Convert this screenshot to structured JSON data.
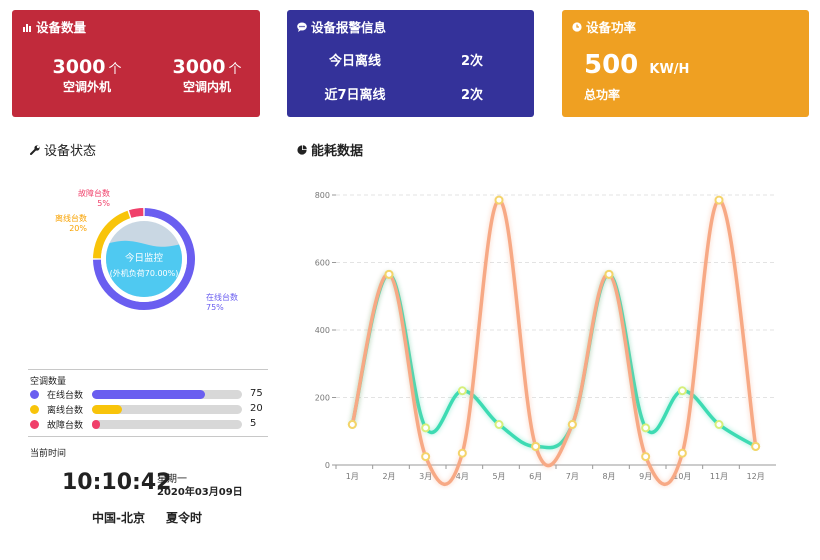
{
  "device_count": {
    "title": "设备数量",
    "icon": "bar-chart-icon",
    "outdoor": {
      "value": "3000",
      "unit": "个",
      "label": "空调外机"
    },
    "indoor": {
      "value": "3000",
      "unit": "个",
      "label": "空调内机"
    },
    "color": "#c12a3b"
  },
  "alarm_info": {
    "title": "设备报警信息",
    "icon": "chat-bubble-icon",
    "rows": [
      {
        "label": "今日离线",
        "value": "2次"
      },
      {
        "label": "近7日离线",
        "value": "2次"
      }
    ],
    "color": "#34329a"
  },
  "power": {
    "title": "设备功率",
    "icon": "clock-icon",
    "value": "500",
    "unit": "KW/H",
    "label": "总功率",
    "color": "#efa022"
  },
  "device_status": {
    "title": "设备状态",
    "icon": "wrench-icon",
    "center_label": "今日监控",
    "center_sub": "(外机负荷70.00%)",
    "load_fraction": 0.7,
    "segments": [
      {
        "name": "在线台数",
        "pct": "75%",
        "value": 75,
        "color": "#6a5ef0"
      },
      {
        "name": "离线台数",
        "pct": "20%",
        "value": 20,
        "color": "#f8c40a"
      },
      {
        "name": "故障台数",
        "pct": "5%",
        "value": 5,
        "color": "#f0406a"
      }
    ]
  },
  "ac_count": {
    "title": "空调数量",
    "rows": [
      {
        "label": "在线台数",
        "value": "75",
        "fraction": 0.75,
        "color": "#6a5ef0"
      },
      {
        "label": "离线台数",
        "value": "20",
        "fraction": 0.2,
        "color": "#f8c40a"
      },
      {
        "label": "故障台数",
        "value": "5",
        "fraction": 0.05,
        "color": "#f0406a"
      }
    ]
  },
  "clock": {
    "title": "当前时间",
    "time": "10:10:42",
    "weekday": "星期一",
    "date": "2020年03月09日",
    "location": "中国-北京",
    "dst": "夏令时"
  },
  "energy": {
    "title": "能耗数据",
    "icon": "pie-chart-icon"
  },
  "chart_data": {
    "type": "line",
    "title": "",
    "xlabel": "",
    "ylabel": "",
    "categories": [
      "1月",
      "2月",
      "3月",
      "4月",
      "5月",
      "6月",
      "7月",
      "8月",
      "9月",
      "10月",
      "11月",
      "12月"
    ],
    "yticks": [
      "0",
      "200",
      "400",
      "600",
      "800"
    ],
    "ylim": [
      0,
      800
    ],
    "grid": "horizontal-dashed",
    "series": [
      {
        "color": "#3ddbb3",
        "values": [
          120,
          565,
          110,
          220,
          120,
          55,
          120,
          565,
          110,
          220,
          120,
          55
        ]
      },
      {
        "color": "#f7a985",
        "values": [
          120,
          565,
          25,
          35,
          785,
          55,
          120,
          565,
          25,
          35,
          785,
          55
        ]
      }
    ]
  }
}
